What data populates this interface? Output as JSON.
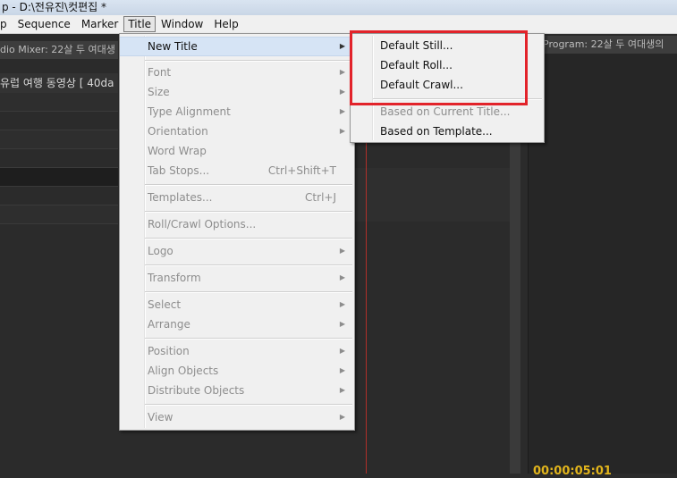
{
  "window": {
    "title": "p - D:\\전유진\\컷편집 *"
  },
  "menubar": [
    "p",
    "Sequence",
    "Marker",
    "Title",
    "Window",
    "Help"
  ],
  "panels": {
    "audio_mixer": "dio Mixer: 22살 두 여대생",
    "program": "Program: 22살 두 여대생의",
    "project": "유럽 여행 동영상 [ 40da",
    "timecode": "00:00:05:01"
  },
  "title_menu": {
    "items": [
      {
        "label": "New Title",
        "enabled": true,
        "submenu": true,
        "highlighted": true
      },
      {
        "label": "Font",
        "enabled": false,
        "submenu": true
      },
      {
        "label": "Size",
        "enabled": false,
        "submenu": true
      },
      {
        "label": "Type Alignment",
        "enabled": false,
        "submenu": true
      },
      {
        "label": "Orientation",
        "enabled": false,
        "submenu": true
      },
      {
        "label": "Word Wrap",
        "enabled": false
      },
      {
        "label": "Tab Stops...",
        "enabled": false,
        "shortcut": "Ctrl+Shift+T"
      },
      {
        "label": "Templates...",
        "enabled": false,
        "shortcut": "Ctrl+J"
      },
      {
        "label": "Roll/Crawl Options...",
        "enabled": false
      },
      {
        "label": "Logo",
        "enabled": false,
        "submenu": true
      },
      {
        "label": "Transform",
        "enabled": false,
        "submenu": true
      },
      {
        "label": "Select",
        "enabled": false,
        "submenu": true
      },
      {
        "label": "Arrange",
        "enabled": false,
        "submenu": true
      },
      {
        "label": "Position",
        "enabled": false,
        "submenu": true
      },
      {
        "label": "Align Objects",
        "enabled": false,
        "submenu": true
      },
      {
        "label": "Distribute Objects",
        "enabled": false,
        "submenu": true
      },
      {
        "label": "View",
        "enabled": false,
        "submenu": true
      }
    ]
  },
  "new_title_submenu": {
    "items": [
      {
        "label": "Default Still...",
        "enabled": true
      },
      {
        "label": "Default Roll...",
        "enabled": true
      },
      {
        "label": "Default Crawl...",
        "enabled": true
      },
      {
        "label": "Based on Current Title...",
        "enabled": false
      },
      {
        "label": "Based on Template...",
        "enabled": true
      }
    ]
  },
  "colors": {
    "highlight_box": "#e2232a",
    "timecode": "#e2b51c",
    "playhead": "#b0302a"
  }
}
